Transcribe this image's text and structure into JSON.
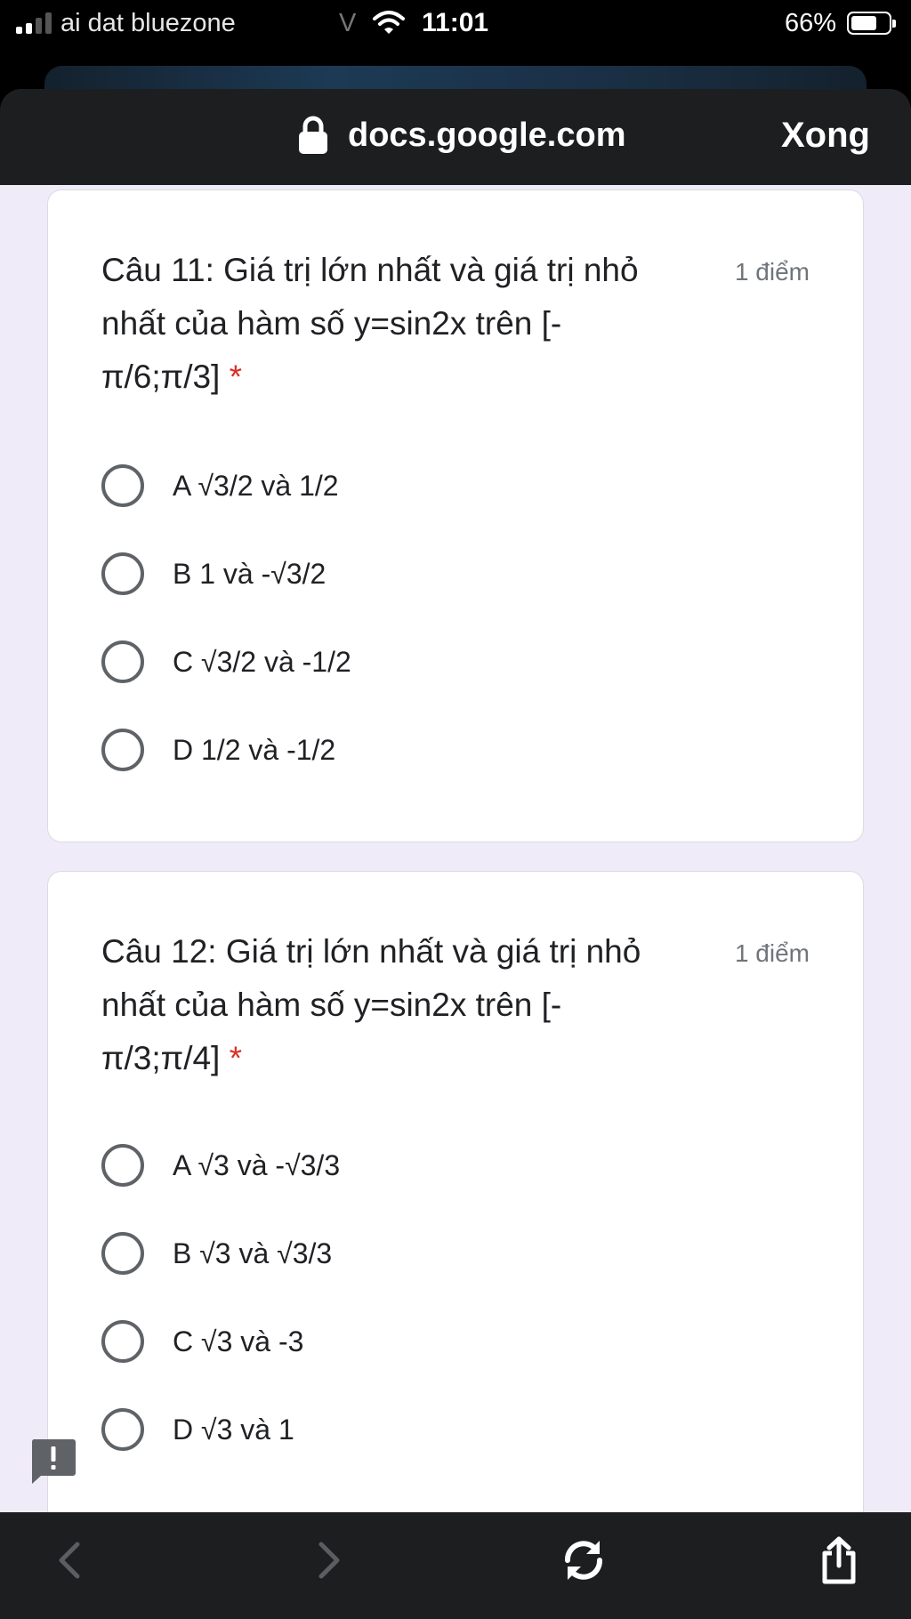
{
  "status_bar": {
    "carrier": "ai dat bluezone",
    "vpn": "V",
    "time": "11:01",
    "battery": "66%"
  },
  "browser": {
    "url": "docs.google.com",
    "done_label": "Xong"
  },
  "questions": [
    {
      "title": "Câu 11: Giá trị lớn nhất và giá trị nhỏ nhất của hàm số y=sin2x trên [-π/6;π/3]",
      "required_mark": "*",
      "points": "1 điểm",
      "options": [
        "A √3/2 và 1/2",
        "B 1 và -√3/2",
        "C √3/2 và -1/2",
        "D 1/2 và -1/2"
      ]
    },
    {
      "title": "Câu 12: Giá trị lớn nhất và giá trị nhỏ nhất của hàm số y=sin2x trên [-π/3;π/4]",
      "required_mark": "*",
      "points": "1 điểm",
      "options": [
        "A √3 và -√3/3",
        "B √3 và √3/3",
        "C √3 và -3",
        "D √3 và 1"
      ]
    }
  ],
  "colors": {
    "page_bg": "#f0ebf8",
    "required": "#d93025",
    "toolbar_bg": "#1d1e20"
  }
}
